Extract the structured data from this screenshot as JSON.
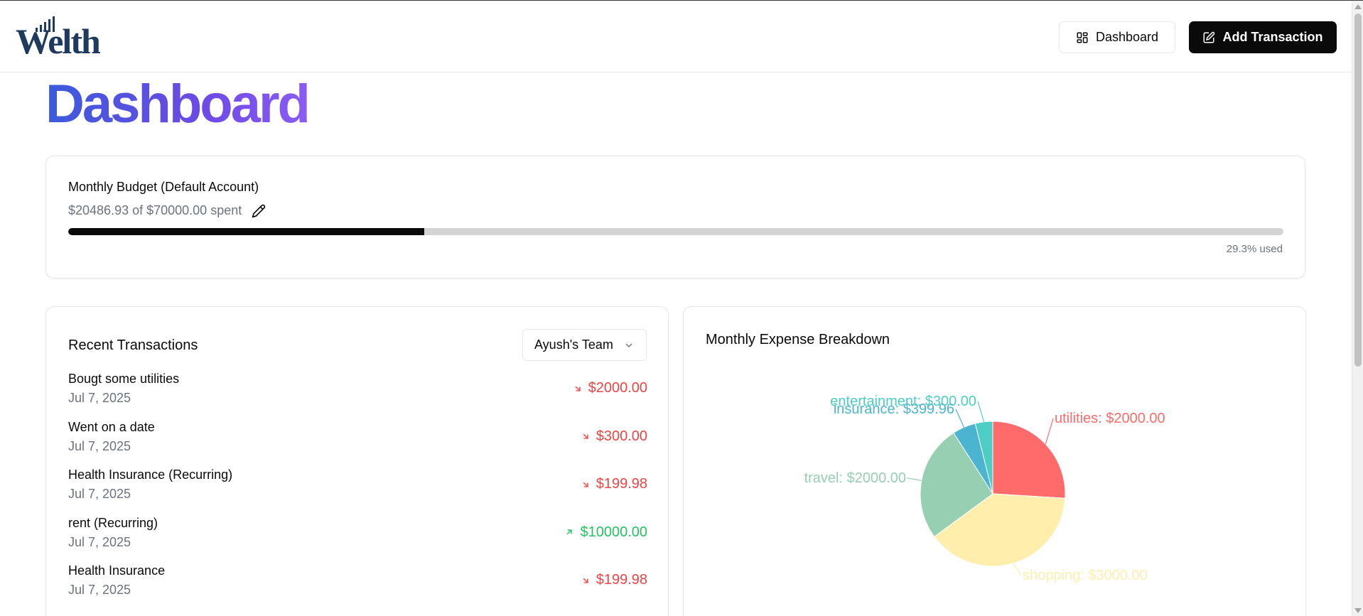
{
  "header": {
    "logo_text": "Welth",
    "dashboard_button": "Dashboard",
    "add_transaction_button": "Add Transaction"
  },
  "page": {
    "title": "Dashboard"
  },
  "budget": {
    "title": "Monthly Budget (Default Account)",
    "spent_text": "$20486.93 of $70000.00 spent",
    "used_text": "29.3% used",
    "progress_fraction": 0.293
  },
  "transactions": {
    "title": "Recent Transactions",
    "account_select": "Ayush's Team",
    "items": [
      {
        "name": "Bougt some utilities",
        "date": "Jul 7, 2025",
        "amount": "$2000.00",
        "type": "expense"
      },
      {
        "name": "Went on a date",
        "date": "Jul 7, 2025",
        "amount": "$300.00",
        "type": "expense"
      },
      {
        "name": "Health Insurance (Recurring)",
        "date": "Jul 7, 2025",
        "amount": "$199.98",
        "type": "expense"
      },
      {
        "name": "rent (Recurring)",
        "date": "Jul 7, 2025",
        "amount": "$10000.00",
        "type": "income"
      },
      {
        "name": "Health Insurance",
        "date": "Jul 7, 2025",
        "amount": "$199.98",
        "type": "expense"
      }
    ]
  },
  "expense_chart": {
    "title": "Monthly Expense Breakdown"
  },
  "chart_data": {
    "type": "pie",
    "title": "Monthly Expense Breakdown",
    "slices": [
      {
        "label": "utilities: $2000.00",
        "category": "utilities",
        "value": 2000.0,
        "color": "#ff6b6b"
      },
      {
        "label": "shopping: $3000.00",
        "category": "shopping",
        "value": 3000.0,
        "color": "#ffeeac"
      },
      {
        "label": "travel: $2000.00",
        "category": "travel",
        "value": 2000.0,
        "color": "#96cfb1"
      },
      {
        "label": "insurance: $399.96",
        "category": "insurance",
        "value": 399.96,
        "color": "#4bb4d0"
      },
      {
        "label": "entertainment: $300.00",
        "category": "entertainment",
        "value": 300.0,
        "color": "#4ecdc4"
      }
    ]
  },
  "colors": {
    "expense": "#ef4444",
    "income": "#22c55e",
    "title_gradient_start": "#3b5bdb",
    "title_gradient_end": "#8b5cf6"
  }
}
